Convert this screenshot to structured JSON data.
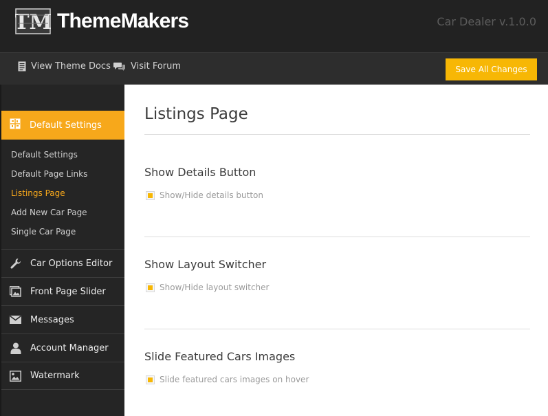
{
  "header": {
    "brand": "ThemeMakers",
    "logo_letters": "TM",
    "version": "Car Dealer v.1.0.0"
  },
  "toolbar": {
    "docs_label": "View Theme Docs",
    "forum_label": "Visit Forum",
    "save_label": "Save All Changes",
    "icons": {
      "docs": "document-icon",
      "forum": "chat-bubbles-icon"
    },
    "accent_color": "#f7b705"
  },
  "sidebar": {
    "active": {
      "label": "Default Settings",
      "icon": "settings-grid-icon",
      "color": "#f7a81b"
    },
    "subitems": [
      {
        "label": "Default Settings",
        "current": false
      },
      {
        "label": "Default Page Links",
        "current": false
      },
      {
        "label": "Listings Page",
        "current": true
      },
      {
        "label": "Add New Car Page",
        "current": false
      },
      {
        "label": "Single Car Page",
        "current": false
      }
    ],
    "menu": [
      {
        "label": "Car Options Editor",
        "icon": "wrench-icon"
      },
      {
        "label": "Front Page Slider",
        "icon": "image-gallery-icon"
      },
      {
        "label": "Messages",
        "icon": "envelope-icon"
      },
      {
        "label": "Account Manager",
        "icon": "user-icon"
      },
      {
        "label": "Watermark",
        "icon": "image-icon"
      }
    ]
  },
  "main": {
    "title": "Listings Page",
    "sections": [
      {
        "title": "Show Details Button",
        "checkbox_label": "Show/Hide details button",
        "checked": true
      },
      {
        "title": "Show Layout Switcher",
        "checkbox_label": "Show/Hide layout switcher",
        "checked": true
      },
      {
        "title": "Slide Featured Cars Images",
        "checkbox_label": "Slide featured cars images on hover",
        "checked": true
      }
    ]
  }
}
